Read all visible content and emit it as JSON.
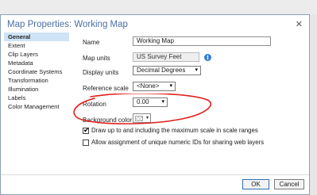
{
  "dialog": {
    "title": "Map Properties: Working Map",
    "close_glyph": "✕"
  },
  "sidebar": {
    "items": [
      {
        "label": "General",
        "active": true
      },
      {
        "label": "Extent"
      },
      {
        "label": "Clip Layers"
      },
      {
        "label": "Metadata"
      },
      {
        "label": "Coordinate Systems"
      },
      {
        "label": "Transformation"
      },
      {
        "label": "Illumination"
      },
      {
        "label": "Labels"
      },
      {
        "label": "Color Management"
      }
    ]
  },
  "general": {
    "name_label": "Name",
    "name_value": "Working Map",
    "map_units_label": "Map units",
    "map_units_value": "US Survey Feet",
    "info_icon": "info-icon",
    "display_units_label": "Display units",
    "display_units_value": "Decimal Degrees",
    "reference_scale_label": "Reference scale",
    "reference_scale_value": "<None>",
    "rotation_label": "Rotation",
    "rotation_value": "0.00",
    "background_color_label": "Background color",
    "draw_up_label": "Draw up to and including the maximum scale in scale ranges",
    "draw_up_checked": true,
    "allow_ids_label": "Allow assignment of unique numeric IDs for sharing web layers",
    "allow_ids_checked": false
  },
  "footer": {
    "ok_label": "OK",
    "cancel_label": "Cancel"
  },
  "colors": {
    "title_blue": "#4b6fa3",
    "selected_nav": "#cfe3f6",
    "annotation_red": "#e0201b",
    "info_blue": "#2f7bd8"
  }
}
